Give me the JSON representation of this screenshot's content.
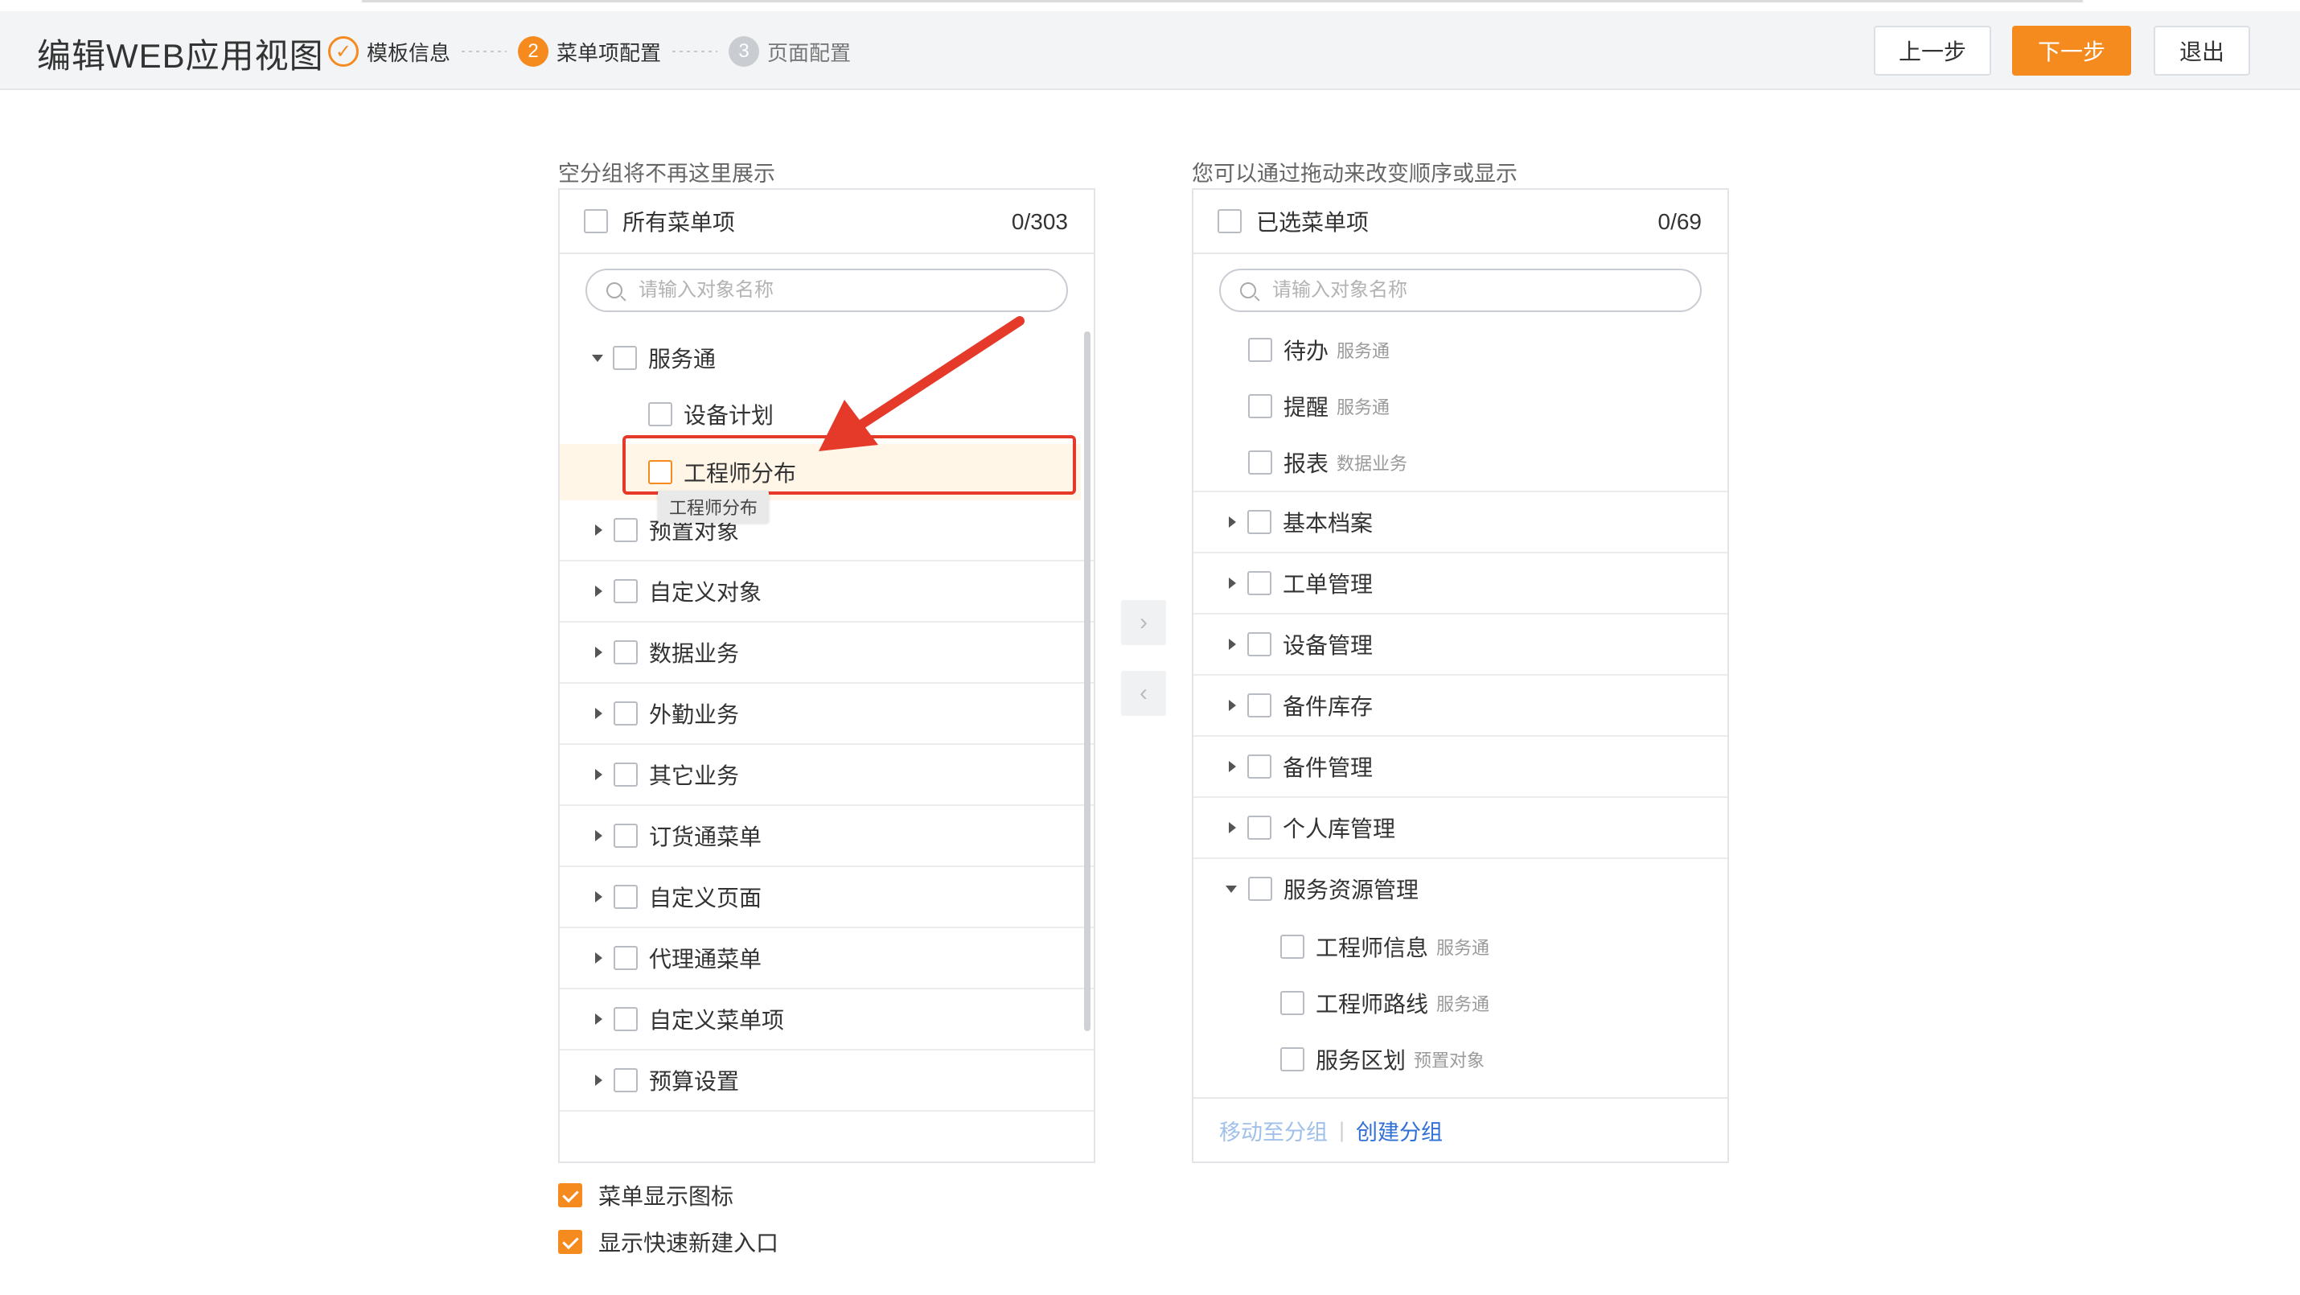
{
  "header": {
    "title": "编辑WEB应用视图",
    "steps": [
      {
        "num": "✓",
        "label": "模板信息",
        "state": "done"
      },
      {
        "num": "2",
        "label": "菜单项配置",
        "state": "active"
      },
      {
        "num": "3",
        "label": "页面配置",
        "state": "pending"
      }
    ],
    "buttons": {
      "prev": "上一步",
      "next": "下一步",
      "exit": "退出"
    }
  },
  "left_panel": {
    "caption": "空分组将不再这里展示",
    "head_label": "所有菜单项",
    "count": "0/303",
    "search_placeholder": "请输入对象名称",
    "group_expanded": "服务通",
    "children": [
      "设备计划",
      "工程师分布"
    ],
    "tooltip": "工程师分布",
    "groups": [
      "预置对象",
      "自定义对象",
      "数据业务",
      "外勤业务",
      "其它业务",
      "订货通菜单",
      "自定义页面",
      "代理通菜单",
      "自定义菜单项",
      "预算设置"
    ]
  },
  "transfer": {
    "right_arrow": "›",
    "left_arrow": "‹"
  },
  "right_panel": {
    "caption": "您可以通过拖动来改变顺序或显示",
    "head_label": "已选菜单项",
    "count": "0/69",
    "search_placeholder": "请输入对象名称",
    "top_items": [
      {
        "label": "待办",
        "tag": "服务通"
      },
      {
        "label": "提醒",
        "tag": "服务通"
      },
      {
        "label": "报表",
        "tag": "数据业务"
      }
    ],
    "groups": [
      "基本档案",
      "工单管理",
      "设备管理",
      "备件库存",
      "备件管理",
      "个人库管理"
    ],
    "expanded_group": "服务资源管理",
    "expanded_children": [
      {
        "label": "工程师信息",
        "tag": "服务通"
      },
      {
        "label": "工程师路线",
        "tag": "服务通"
      },
      {
        "label": "服务区划",
        "tag": "预置对象"
      }
    ],
    "footer": {
      "move": "移动至分组",
      "create": "创建分组"
    }
  },
  "options": [
    {
      "label": "菜单显示图标",
      "checked": true
    },
    {
      "label": "显示快速新建入口",
      "checked": true
    }
  ],
  "colors": {
    "accent": "#f58a1f",
    "annotation": "#e5392a",
    "link": "#2f6fd6"
  }
}
